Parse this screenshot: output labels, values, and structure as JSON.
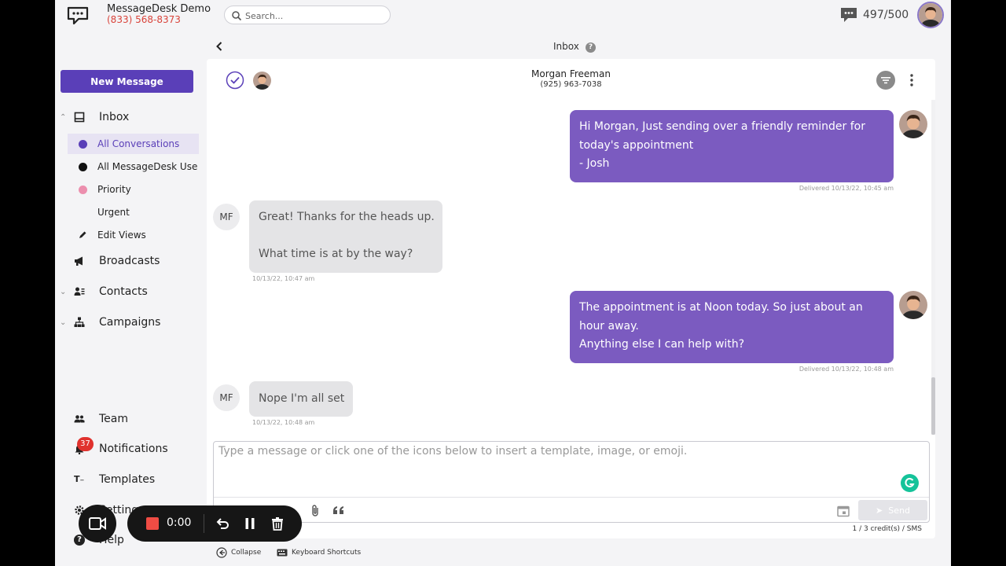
{
  "brand": {
    "name": "MessageDesk Demo",
    "phone": "(833) 568-8373"
  },
  "search": {
    "placeholder": "Search..."
  },
  "credits": {
    "text": "497/500"
  },
  "sidebar": {
    "new_message": "New Message",
    "inbox": "Inbox",
    "sub_items": [
      {
        "label": "All Conversations",
        "dot_color": "#5a3fb8"
      },
      {
        "label": "All MessageDesk Use",
        "dot_color": "#111111"
      },
      {
        "label": "Priority",
        "dot_color": "#ec8fae"
      },
      {
        "label": "Urgent",
        "dot_color": ""
      },
      {
        "label": "Edit Views",
        "icon": "pencil-icon"
      }
    ],
    "broadcasts": "Broadcasts",
    "contacts": "Contacts",
    "campaigns": "Campaigns",
    "team": "Team",
    "notifications": "Notifications",
    "notifications_count": "37",
    "templates": "Templates",
    "settings": "Settings",
    "help": "Help"
  },
  "header": {
    "title": "Inbox",
    "help_icon": "?"
  },
  "conversation": {
    "contact_name": "Morgan Freeman",
    "contact_phone": "(925) 963-7038",
    "messages": [
      {
        "direction": "out",
        "lines": [
          "Hi Morgan, Just sending over a friendly reminder for",
          "today's appointment",
          "- Josh"
        ],
        "meta": "Delivered 10/13/22, 10:45 am"
      },
      {
        "direction": "in",
        "initials": "MF",
        "lines": [
          "Great! Thanks for the heads up.",
          "",
          "What time is at by the way?"
        ],
        "meta": "10/13/22, 10:47 am"
      },
      {
        "direction": "out",
        "lines": [
          "The appointment is at Noon today. So just about an",
          "hour away.",
          "Anything else I can help with?"
        ],
        "meta": "Delivered 10/13/22, 10:48 am"
      },
      {
        "direction": "in",
        "initials": "MF",
        "lines": [
          "Nope I'm all set"
        ],
        "meta": "10/13/22, 10:48 am"
      }
    ]
  },
  "composer": {
    "placeholder": "Type a message or click one of the icons below to insert a template, image, or emoji.",
    "send_label": "Send",
    "sms_info": "1 / 3 credit(s) / SMS"
  },
  "footer": {
    "collapse": "Collapse",
    "shortcuts": "Keyboard Shortcuts"
  },
  "recorder": {
    "time": "0:00"
  },
  "colors": {
    "accent": "#5a3fb8",
    "outgoing_bubble": "#7b5bc0",
    "incoming_bubble": "#e4e4e6",
    "phone": "#d9433a",
    "badge": "#e0322e",
    "record": "#ef4c44"
  }
}
